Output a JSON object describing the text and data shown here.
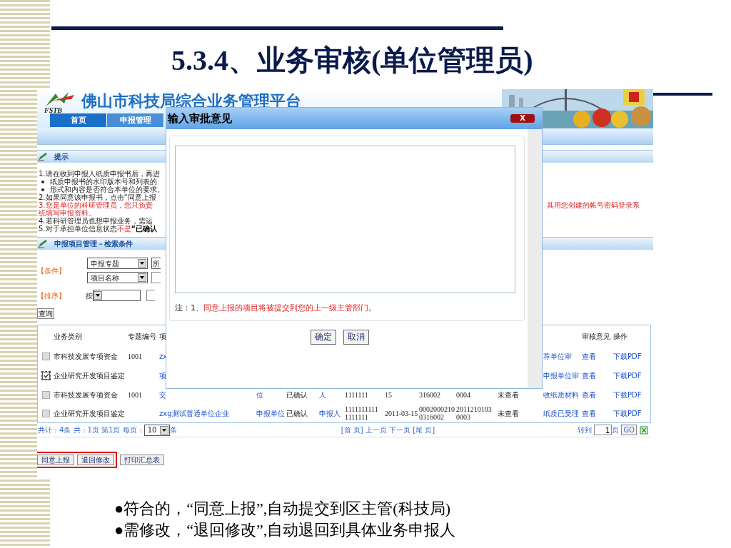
{
  "slide": {
    "title": "5.3.4、业务审核(单位管理员)",
    "bullets": [
      "●符合的，“同意上报”,自动提交到区主管(科技局)",
      "●需修改，“退回修改”,自动退回到具体业务申报人"
    ]
  },
  "app": {
    "header": {
      "title": "佛山市科技局综合业务管理平台",
      "logo_text": "FSTB"
    },
    "nav": [
      {
        "label": "首页",
        "selected": true
      },
      {
        "label": "申报管理",
        "selected": false
      }
    ],
    "tips": {
      "title": "提示",
      "lines": [
        {
          "kind": "plain",
          "parts": [
            {
              "kind": "plain",
              "text": "1.请在收到申报人纸质申报书后，再进"
            }
          ]
        },
        {
          "kind": "bullet",
          "parts": [
            {
              "kind": "plain",
              "text": "纸质申报书的水印版本号和列表的"
            }
          ]
        },
        {
          "kind": "bullet",
          "parts": [
            {
              "kind": "plain",
              "text": "形式和内容是否符合本单位的要求。"
            }
          ]
        },
        {
          "kind": "plain",
          "parts": [
            {
              "kind": "plain",
              "text": "2.如果同意该申报书，点击“同意上报"
            }
          ]
        },
        {
          "kind": "split",
          "parts": [
            {
              "kind": "red",
              "text": "3.您是单位的科研管理员，您只负责"
            },
            {
              "kind": "red",
              "text": "其用您创建的帐号密码登录系"
            }
          ]
        },
        {
          "kind": "plain",
          "parts": [
            {
              "kind": "red",
              "text": "统填写申报资料。"
            }
          ]
        },
        {
          "kind": "plain",
          "parts": [
            {
              "kind": "plain",
              "text": "4.若科研管理员也想申报业务，需运"
            }
          ]
        },
        {
          "kind": "plain",
          "parts": [
            {
              "kind": "plain",
              "text": "5.对于承担单位信息状态"
            },
            {
              "kind": "red",
              "text": "不是"
            },
            {
              "kind": "bold",
              "text": "“已确认"
            }
          ]
        }
      ]
    },
    "search": {
      "title": "申报项目管理－检索条件",
      "condition_label": "【条件】",
      "selects": [
        "申报专题",
        "项目名称"
      ],
      "second_select": "所",
      "sort_label": "【排序】",
      "sort_by": "按",
      "query_button": "查询"
    },
    "table": {
      "header": {
        "category": "业务类别",
        "topic_no": "专题编号",
        "project_name": "项",
        "review": "审核意见",
        "action": "操作"
      },
      "rows": [
        {
          "checked": false,
          "category": "市科技发展专项资金",
          "topic_no": "1001",
          "project_name": "zx",
          "flow_status": "荐单位审",
          "review": "查看",
          "action": "下载PDF"
        },
        {
          "checked": true,
          "category": "企业研究开发项目鉴定",
          "project_name": "项",
          "flow_status": "申报单位审",
          "review": "查看",
          "action": "下载PDF"
        },
        {
          "checked": false,
          "category": "市科技发展专项资金",
          "topic_no": "1001",
          "project_name": "交",
          "unit_type": "位",
          "confirm_status": "已确认",
          "applicant": "人",
          "applicant_no": "1111111",
          "date": "15",
          "project_no": "316002",
          "serial_no": "0004",
          "view_status": "未查看",
          "flow_status": "收纸质材料",
          "review": "查看",
          "action": "下载PDF"
        },
        {
          "checked": false,
          "category": "企业研究开发项目鉴定",
          "project_name": "zxg测试普通单位企业",
          "unit_type": "申报单位",
          "confirm_status": "已确认",
          "applicant": "申报人",
          "applicant_no": "1111111111 1111111",
          "date": "2011-03-15",
          "project_no": "0002000210 0316002",
          "serial_no": "2011210103 0003",
          "view_status": "未查看",
          "flow_status": "纸质已受理",
          "review": "查看",
          "action": "下载PDF"
        }
      ]
    },
    "pager": {
      "summary": "共计：4条 共：1页 第1页 每页：",
      "page_size": "10",
      "unit": "条",
      "nav": "[首 页] 上一页 下一页 [尾 页]",
      "goto_label": "转到",
      "goto_value": "1",
      "page_label": "页",
      "go_button": "GO"
    },
    "actions": [
      {
        "label": "同意上报",
        "highlighted": true
      },
      {
        "label": "退回修改",
        "highlighted": true
      },
      {
        "label": "打印汇总表",
        "highlighted": false
      }
    ]
  },
  "dialog": {
    "title": "输入审批意见",
    "close": "X",
    "note_prefix": "注：1、",
    "note": "同意上报的项目将被提交到您的上一级主管部门。",
    "buttons": [
      "确定",
      "取消"
    ]
  }
}
